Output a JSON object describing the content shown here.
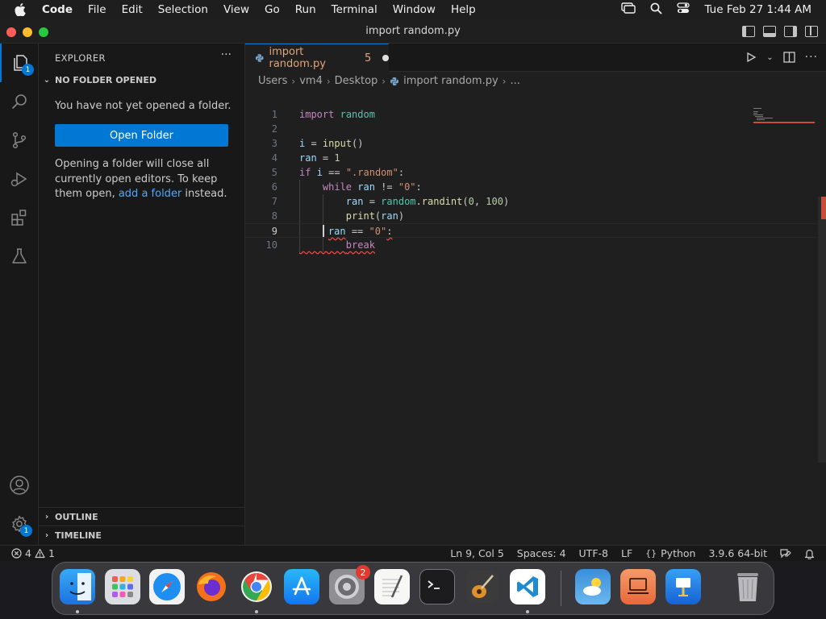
{
  "menubar": {
    "app": "Code",
    "items": [
      "File",
      "Edit",
      "Selection",
      "View",
      "Go",
      "Run",
      "Terminal",
      "Window",
      "Help"
    ],
    "clock": "Tue Feb 27  1:44 AM"
  },
  "window": {
    "title": "import random.py"
  },
  "activity": {
    "explorer_badge": "1",
    "accounts_badge": "1"
  },
  "sidebar": {
    "title": "EXPLORER",
    "more": "···",
    "section": "NO FOLDER OPENED",
    "no_folder_text": "You have not yet opened a folder.",
    "open_folder_label": "Open Folder",
    "info_part1": "Opening a folder will close all currently open editors. To keep them open, ",
    "info_link": "add a folder",
    "info_part2": " instead.",
    "outline": "OUTLINE",
    "timeline": "TIMELINE"
  },
  "editor": {
    "tab_label": "import random.py",
    "tab_problems": "5",
    "breadcrumb": [
      "Users",
      "vm4",
      "Desktop",
      "import random.py",
      "..."
    ],
    "line_numbers": [
      "1",
      "2",
      "3",
      "4",
      "5",
      "6",
      "7",
      "8",
      "9",
      "10"
    ],
    "current_line": "9"
  },
  "statusbar": {
    "errors": "4",
    "warnings": "1",
    "position": "Ln 9, Col 5",
    "spaces": "Spaces: 4",
    "encoding": "UTF-8",
    "eol": "LF",
    "language": "Python",
    "interpreter": "3.9.6 64-bit"
  },
  "dock": {
    "apps": [
      "Finder",
      "Launchpad",
      "Safari",
      "Firefox",
      "Chrome",
      "App Store",
      "System Settings",
      "TextEdit",
      "Terminal",
      "GarageBand",
      "Visual Studio Code",
      "Weather",
      "Screen Sharing",
      "Keynote",
      "Trash"
    ],
    "settings_badge": "2"
  },
  "colors": {
    "accent": "#0078d4",
    "tab_modified": "#e2a47a",
    "error": "#f14c4c"
  }
}
